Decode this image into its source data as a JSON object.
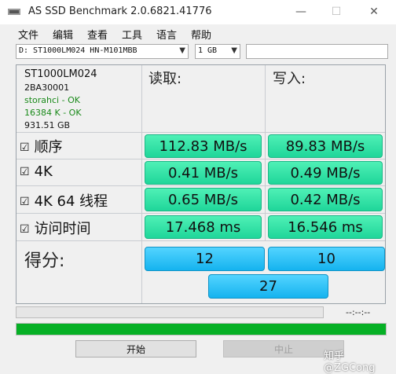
{
  "window": {
    "title": "AS SSD Benchmark 2.0.6821.41776",
    "minimize": "—",
    "maximize": "☐",
    "close": "✕"
  },
  "menu": [
    "文件",
    "编辑",
    "查看",
    "工具",
    "语言",
    "帮助"
  ],
  "toolbar": {
    "drive": "D: ST1000LM024 HN-M101MBB",
    "size": "1 GB",
    "extra": ""
  },
  "info": {
    "model": "ST1000LM024",
    "firmware": "2BA30001",
    "driver": "storahci - OK",
    "alignment": "16384 K - OK",
    "capacity": "931.51 GB"
  },
  "headers": {
    "read": "读取:",
    "write": "写入:"
  },
  "rows": [
    {
      "label": "顺序",
      "read": "112.83 MB/s",
      "write": "89.83 MB/s"
    },
    {
      "label": "4K",
      "read": "0.41 MB/s",
      "write": "0.49 MB/s"
    },
    {
      "label": "4K 64 线程",
      "read": "0.65 MB/s",
      "write": "0.42 MB/s"
    },
    {
      "label": "访问时间",
      "read": "17.468 ms",
      "write": "16.546 ms"
    }
  ],
  "score": {
    "label": "得分:",
    "read": "12",
    "write": "10",
    "total": "27"
  },
  "status": {
    "timer": "--:--:--",
    "progress_fraction": 1.0
  },
  "buttons": {
    "start": "开始",
    "stop": "中止"
  },
  "watermark": "知乎 @ZGCong",
  "colors": {
    "result_green": "#2edc9f",
    "score_blue": "#22bdf5",
    "progress_green": "#06b025"
  }
}
